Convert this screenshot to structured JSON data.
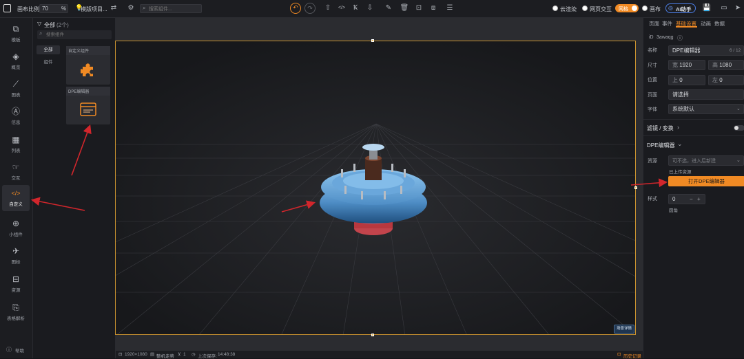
{
  "topbar": {
    "scale_label": "画布比例",
    "scale_value": "70",
    "scale_unit": "%",
    "template_label": "模版项目...",
    "search_placeholder": "搜索组件...",
    "toggles": [
      {
        "label": "云渲染"
      },
      {
        "label": "网页交互"
      },
      {
        "label": "网格"
      },
      {
        "label": "画布"
      }
    ],
    "ai_label": "AI助手"
  },
  "rail": {
    "items": [
      {
        "id": "template",
        "label": "模板",
        "icon": "template-icon",
        "glyph": "⧉"
      },
      {
        "id": "overview",
        "label": "概览",
        "icon": "overview-icon",
        "glyph": "◈"
      },
      {
        "id": "chart",
        "label": "图表",
        "icon": "chart-icon",
        "glyph": "⟋"
      },
      {
        "id": "info",
        "label": "信息",
        "icon": "info-icon",
        "glyph": "Ⓐ"
      },
      {
        "id": "table",
        "label": "列表",
        "icon": "table-icon",
        "glyph": "▦"
      },
      {
        "id": "interaction",
        "label": "交互",
        "icon": "interaction-icon",
        "glyph": "☞"
      },
      {
        "id": "custom",
        "label": "自定义",
        "icon": "code-icon",
        "glyph": "</>"
      },
      {
        "id": "widget",
        "label": "小组件",
        "icon": "widget-icon",
        "glyph": "⊕"
      },
      {
        "id": "marker",
        "label": "图标",
        "icon": "marker-icon",
        "glyph": "✈"
      },
      {
        "id": "resource",
        "label": "资源",
        "icon": "resource-icon",
        "glyph": "⊟"
      },
      {
        "id": "parse",
        "label": "表格解析",
        "icon": "parse-icon",
        "glyph": "⎘"
      }
    ],
    "help_label": "帮助"
  },
  "components": {
    "heading": "全部",
    "count": "(2个)",
    "search_placeholder": "搜索组件",
    "filters": [
      "全部",
      "组件"
    ],
    "cards": [
      {
        "title": "自定义组件",
        "icon": "puzzle-icon"
      },
      {
        "title": "DPE编辑器",
        "icon": "browser-window-icon"
      }
    ]
  },
  "canvas": {
    "badge": "场景详情"
  },
  "statusbar": {
    "resolution": "1920×1080",
    "layout_label": "整机走势",
    "layers": "1",
    "saved_label": "上次保存:",
    "saved_time": "14:48:38",
    "history": "历史记录"
  },
  "right": {
    "tabs": [
      "页面",
      "事件",
      "基础设置",
      "动画",
      "数据"
    ],
    "active_tab": 2,
    "id_label": "iD",
    "id_value": "3awaqg",
    "name_label": "名称",
    "name_value": "DPE编辑器",
    "name_count": "6 / 12",
    "size_label": "尺寸",
    "width_prefix": "宽",
    "width_value": "1920",
    "height_prefix": "高",
    "height_value": "1080",
    "pos_label": "位置",
    "top_prefix": "上",
    "top_value": "0",
    "left_prefix": "左",
    "left_value": "0",
    "page_label": "页面",
    "page_placeholder": "请选择",
    "font_label": "字体",
    "font_value": "系统默认",
    "filter_section": "滤镜 / 变换",
    "dpe_section": "DPE编辑器",
    "resource_label": "资源",
    "resource_placeholder": "可不选，进入后新建",
    "uploaded_label": "已上传资源",
    "open_button": "打开DPE编辑器",
    "style_label": "样式",
    "style_value": "0",
    "rounded_label": "圆角"
  },
  "colors": {
    "accent": "#f08a24",
    "frame": "#c9922f",
    "annotation": "#d2262c"
  }
}
